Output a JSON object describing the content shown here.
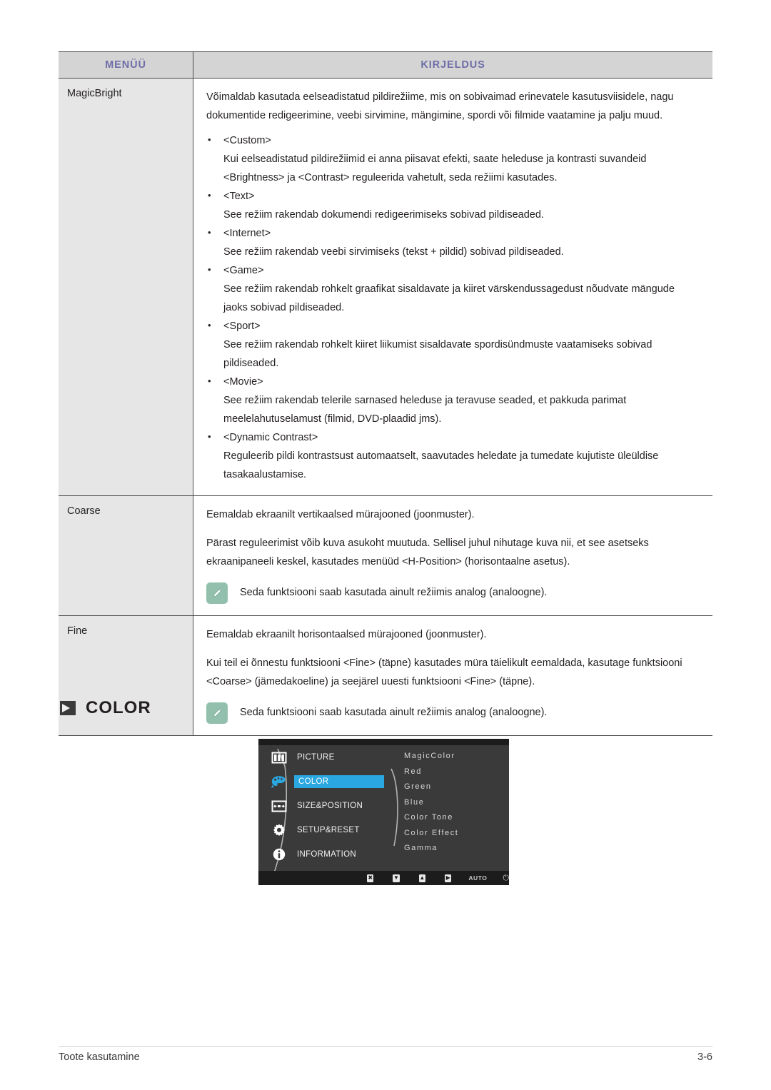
{
  "table": {
    "headers": {
      "menu": "MENÜÜ",
      "description": "KIRJELDUS"
    },
    "header_text_color": "#6e6ea8",
    "header_bg_color": "#d4d4d4",
    "rows": [
      {
        "menu": "MagicBright",
        "intro": "Võimaldab kasutada eelseadistatud pildirežiime, mis on sobivaimad erinevatele kasutusviisidele, nagu dokumentide redigeerimine, veebi sirvimine, mängimine, spordi või filmide vaatamine ja palju muud.",
        "bullets": [
          {
            "title": "<Custom>",
            "body": "Kui eelseadistatud pildirežiimid ei anna piisavat efekti, saate heleduse ja kontrasti suvandeid <Brightness> ja <Contrast> reguleerida vahetult, seda režiimi kasutades."
          },
          {
            "title": "<Text>",
            "body": "See režiim rakendab dokumendi redigeerimiseks sobivad pildiseaded."
          },
          {
            "title": "<Internet>",
            "body": "See režiim rakendab veebi sirvimiseks (tekst + pildid) sobivad pildiseaded."
          },
          {
            "title": "<Game>",
            "body": "See režiim rakendab rohkelt graafikat sisaldavate ja kiiret värskendussagedust nõudvate mängude jaoks sobivad pildiseaded."
          },
          {
            "title": "<Sport>",
            "body": "See režiim rakendab rohkelt kiiret liikumist sisaldavate spordisündmuste vaatamiseks sobivad pildiseaded."
          },
          {
            "title": "<Movie>",
            "body": "See režiim rakendab telerile sarnased heleduse ja teravuse seaded, et pakkuda parimat meelelahutuselamust (filmid, DVD-plaadid jms)."
          },
          {
            "title": "<Dynamic Contrast>",
            "body": "Reguleerib pildi kontrastsust automaatselt, saavutades heledate ja tumedate kujutiste üleüldise tasakaalustamise."
          }
        ]
      },
      {
        "menu": "Coarse",
        "para1": "Eemaldab ekraanilt vertikaalsed mürajooned (joonmuster).",
        "para2": "Pärast reguleerimist võib kuva asukoht muutuda. Sellisel juhul nihutage kuva nii, et see asetseks ekraanipaneeli keskel, kasutades menüüd <H-Position> (horisontaalne asetus).",
        "note": "Seda funktsiooni saab kasutada ainult režiimis analog (analoogne)."
      },
      {
        "menu": "Fine",
        "para1": "Eemaldab ekraanilt horisontaalsed mürajooned (joonmuster).",
        "para2": "Kui teil ei õnnestu funktsiooni <Fine> (täpne) kasutades müra täielikult eemaldada, kasutage funktsiooni <Coarse> (jämedakoeline) ja seejärel uuesti funktsiooni <Fine> (täpne).",
        "note": "Seda funktsiooni saab kasutada ainult režiimis analog (analoogne)."
      }
    ]
  },
  "section": {
    "icon": "arrow-marker-icon",
    "title": "COLOR"
  },
  "osd": {
    "highlight_color": "#2aa7e0",
    "background_color": "#3a3a3a",
    "menu_items": [
      {
        "label": "PICTURE",
        "icon": "picture-icon",
        "active": false
      },
      {
        "label": "COLOR",
        "icon": "color-palette-icon",
        "active": true
      },
      {
        "label": "SIZE&POSITION",
        "icon": "size-position-icon",
        "active": false
      },
      {
        "label": "SETUP&RESET",
        "icon": "gear-icon",
        "active": false
      },
      {
        "label": "INFORMATION",
        "icon": "information-icon",
        "active": false
      }
    ],
    "submenu_items": [
      "MagicColor",
      "Red",
      "Green",
      "Blue",
      "Color Tone",
      "Color Effect",
      "Gamma"
    ],
    "bottom_bar": [
      {
        "label": "✖",
        "name": "close-button-icon"
      },
      {
        "label": "▼",
        "name": "down-arrow-button-icon"
      },
      {
        "label": "▲",
        "name": "up-arrow-button-icon"
      },
      {
        "label": "▶",
        "name": "enter-button-icon"
      },
      {
        "label": "AUTO",
        "name": "auto-button-label"
      },
      {
        "label": "⏻",
        "name": "power-button-icon"
      }
    ]
  },
  "footer": {
    "left": "Toote kasutamine",
    "right": "3-6"
  }
}
